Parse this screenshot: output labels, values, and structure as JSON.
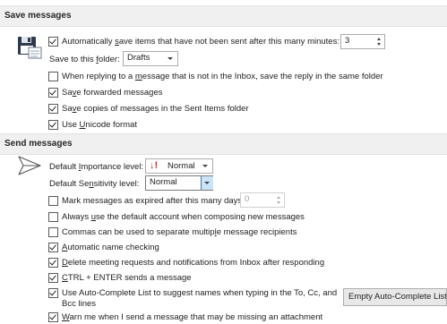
{
  "save_section": {
    "title": "Save messages",
    "autosave_label_pre": "Automatically ",
    "autosave_label_u": "s",
    "autosave_label_post": "ave items that have not been sent after this many minutes:",
    "autosave_checked": true,
    "autosave_minutes": "3",
    "save_folder_label_pre": "Save to this ",
    "save_folder_label_u": "f",
    "save_folder_label_post": "older:",
    "save_folder_value": "Drafts",
    "reply_label_pre": "When replying to a ",
    "reply_label_u": "m",
    "reply_label_post": "essage that is not in the Inbox, save the reply in the same folder",
    "reply_checked": false,
    "forwarded_label_pre": "Sa",
    "forwarded_label_u": "v",
    "forwarded_label_post": "e forwarded messages",
    "forwarded_checked": true,
    "sent_copies_label_pre": "Sa",
    "sent_copies_label_u": "v",
    "sent_copies_label_post": "e copies of messages in the Sent Items folder",
    "sent_copies_checked": true,
    "unicode_label_pre": "Use ",
    "unicode_label_u": "U",
    "unicode_label_post": "nicode format",
    "unicode_checked": true
  },
  "send_section": {
    "title": "Send messages",
    "importance_label_pre": "Default ",
    "importance_label_u": "I",
    "importance_label_post": "mportance level:",
    "importance_value": "Normal",
    "sensitivity_label_pre": "Default Se",
    "sensitivity_label_u": "n",
    "sensitivity_label_post": "sitivity level:",
    "sensitivity_value": "Normal",
    "expired_label_pre": "Mark messa",
    "expired_label_u": "g",
    "expired_label_post": "es as expired after this many days:",
    "expired_checked": false,
    "expired_days": "0",
    "default_account_label_pre": "Always ",
    "default_account_label_u": "u",
    "default_account_label_post": "se the default account when composing new messages",
    "default_account_checked": false,
    "commas_label_pre": "Commas can be used to separate multip",
    "commas_label_u": "l",
    "commas_label_post": "e message recipients",
    "commas_checked": false,
    "name_check_label_pre": "",
    "name_check_label_u": "A",
    "name_check_label_post": "utomatic name checking",
    "name_check_checked": true,
    "delete_label_pre": "",
    "delete_label_u": "D",
    "delete_label_post": "elete meeting requests and notifications from Inbox after responding",
    "delete_checked": true,
    "ctrl_enter_label_pre": "",
    "ctrl_enter_label_u": "C",
    "ctrl_enter_label_post": "TRL + ENTER sends a message",
    "ctrl_enter_checked": true,
    "autocomplete_label_line1": "Use Auto-Complete List to suggest names when typing in the To, Cc, and",
    "autocomplete_label_line2": "Bcc lines",
    "autocomplete_checked": true,
    "empty_autocomplete_button": "Empty Auto-Complete List",
    "warn_label_pre": "",
    "warn_label_u": "W",
    "warn_label_post": "arn me when I send a message that may be missing an attachment",
    "warn_checked": true
  }
}
